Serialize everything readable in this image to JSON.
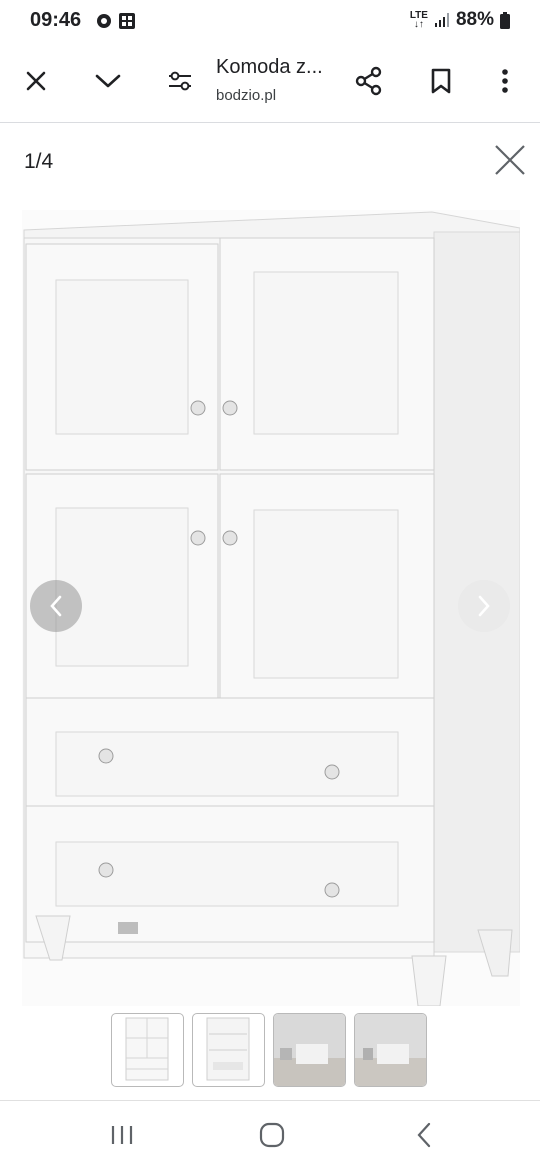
{
  "status_bar": {
    "time": "09:46",
    "network": "LTE",
    "battery": "88%"
  },
  "app_bar": {
    "title": "Komoda z...",
    "subtitle": "bodzio.pl"
  },
  "viewer": {
    "counter": "1/4",
    "thumbnail_count": 4,
    "selected_thumbnail": 1
  },
  "icons": {
    "close": "close-icon",
    "collapse": "chevron-down-icon",
    "settings": "tune-icon",
    "share": "share-icon",
    "bookmark": "bookmark-icon",
    "more": "more-vert-icon"
  },
  "colors": {
    "text": "#202124",
    "divider": "#dadce0",
    "furniture": "#f7f7f7"
  }
}
